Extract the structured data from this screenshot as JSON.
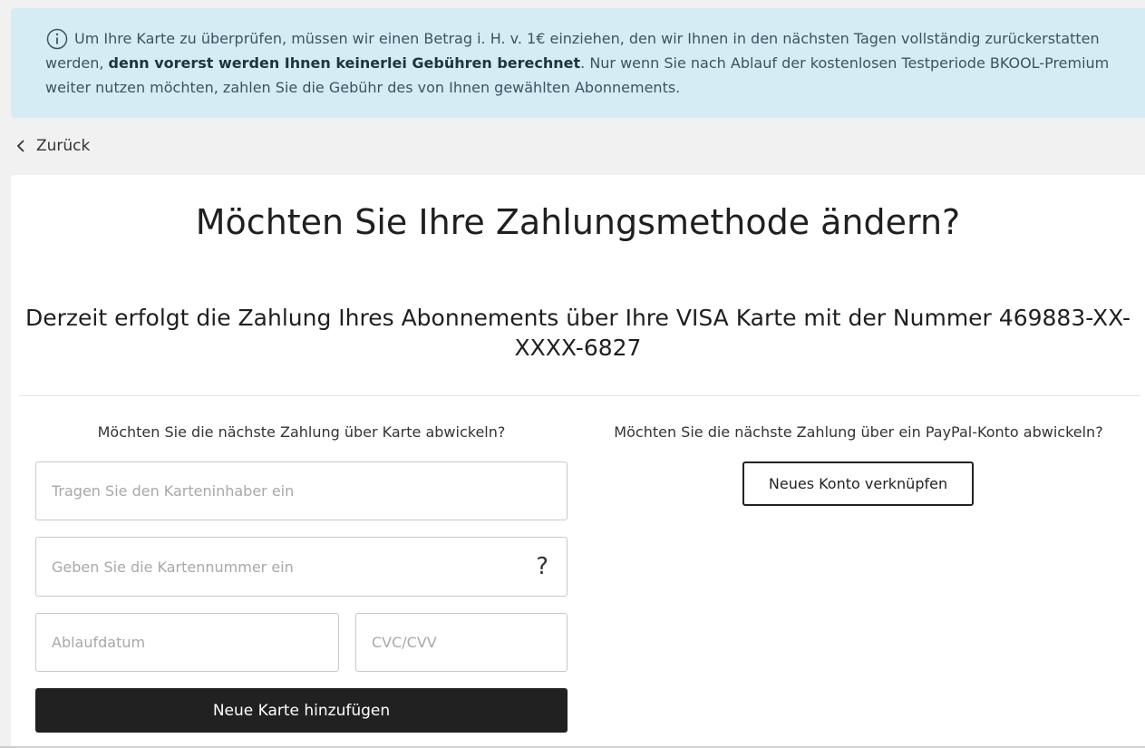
{
  "info_banner": {
    "text_part1": "Um Ihre Karte zu überprüfen, müssen wir einen Betrag i. H. v. 1€ einziehen, den wir Ihnen in den nächsten Tagen vollständig zurückerstatten werden, ",
    "text_bold": "denn vorerst werden Ihnen keinerlei Gebühren berechnet",
    "text_part2": ". Nur wenn Sie nach Ablauf der kostenlosen Testperiode BKOOL-Premium weiter nutzen möchten, zahlen Sie die Gebühr des von Ihnen gewählten Abonnements.",
    "icon": "info-icon"
  },
  "back": {
    "label": "Zurück",
    "icon": "chevron-left-icon"
  },
  "main": {
    "title": "Möchten Sie Ihre Zahlungsmethode ändern?",
    "subtitle": "Derzeit erfolgt die Zahlung Ihres Abonnements über Ihre VISA Karte mit der Nummer 469883-XX-XXXX-6827"
  },
  "card_section": {
    "heading": "Möchten Sie die nächste Zahlung über Karte abwickeln?",
    "holder_placeholder": "Tragen Sie den Karteninhaber ein",
    "number_placeholder": "Geben Sie die Kartennummer ein",
    "help_icon_glyph": "?",
    "expiry_placeholder": "Ablaufdatum",
    "cvc_placeholder": "CVC/CVV",
    "submit_label": "Neue Karte hinzufügen"
  },
  "paypal_section": {
    "heading": "Möchten Sie die nächste Zahlung über ein PayPal-Konto abwickeln?",
    "button_label": "Neues Konto verknüpfen"
  },
  "colors": {
    "banner_bg": "#d5ecf4",
    "banner_text": "#3a5560",
    "page_bg": "#f1f1f1",
    "primary_button": "#212121"
  }
}
